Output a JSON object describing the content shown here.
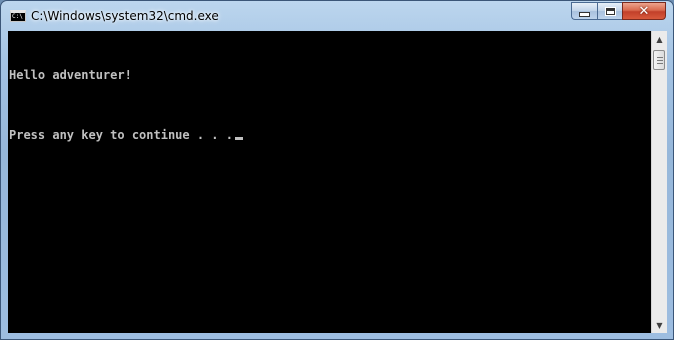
{
  "window": {
    "title": "C:\\Windows\\system32\\cmd.exe",
    "icon": "cmd-icon",
    "icon_text": "C:\\",
    "controls": {
      "minimize": "minimize-icon",
      "maximize": "maximize-icon",
      "close": "close-icon",
      "close_glyph": "✕"
    }
  },
  "console": {
    "lines": [
      "Hello adventurer!",
      "Press any key to continue . . ."
    ],
    "background": "#000000",
    "foreground": "#c0c0c0"
  },
  "scrollbar": {
    "up_arrow": "▲",
    "down_arrow": "▼"
  }
}
